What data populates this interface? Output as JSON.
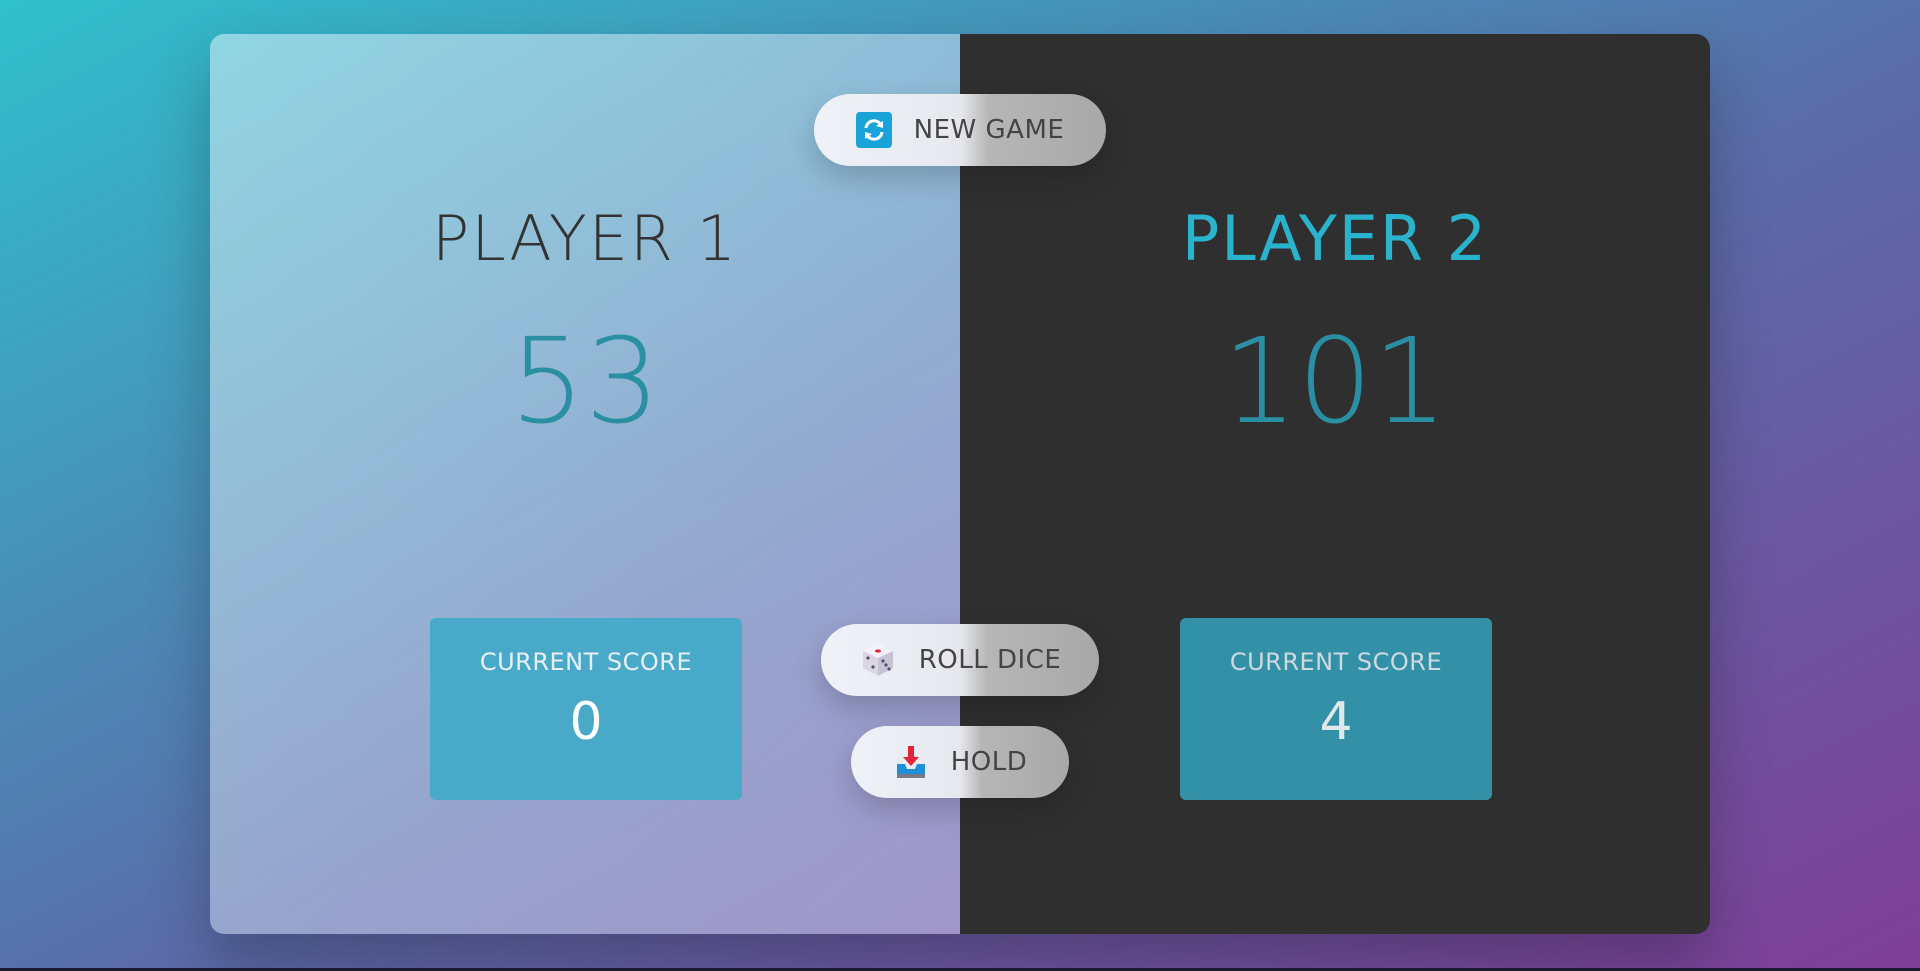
{
  "players": [
    {
      "name": "PLAYER 1",
      "total_score": "53",
      "current_label": "CURRENT SCORE",
      "current_score": "0",
      "active": false
    },
    {
      "name": "PLAYER 2",
      "total_score": "101",
      "current_label": "CURRENT SCORE",
      "current_score": "4",
      "active": true
    }
  ],
  "buttons": {
    "new_game": {
      "label": "NEW GAME",
      "icon": "refresh-icon"
    },
    "roll_dice": {
      "label": "ROLL DICE",
      "icon": "dice-icon"
    },
    "hold": {
      "label": "HOLD",
      "icon": "inbox-tray-icon"
    }
  },
  "colors": {
    "accent": "#2ab3cc",
    "score": "#2b8fa3",
    "active_panel": "#2f2f2f"
  }
}
